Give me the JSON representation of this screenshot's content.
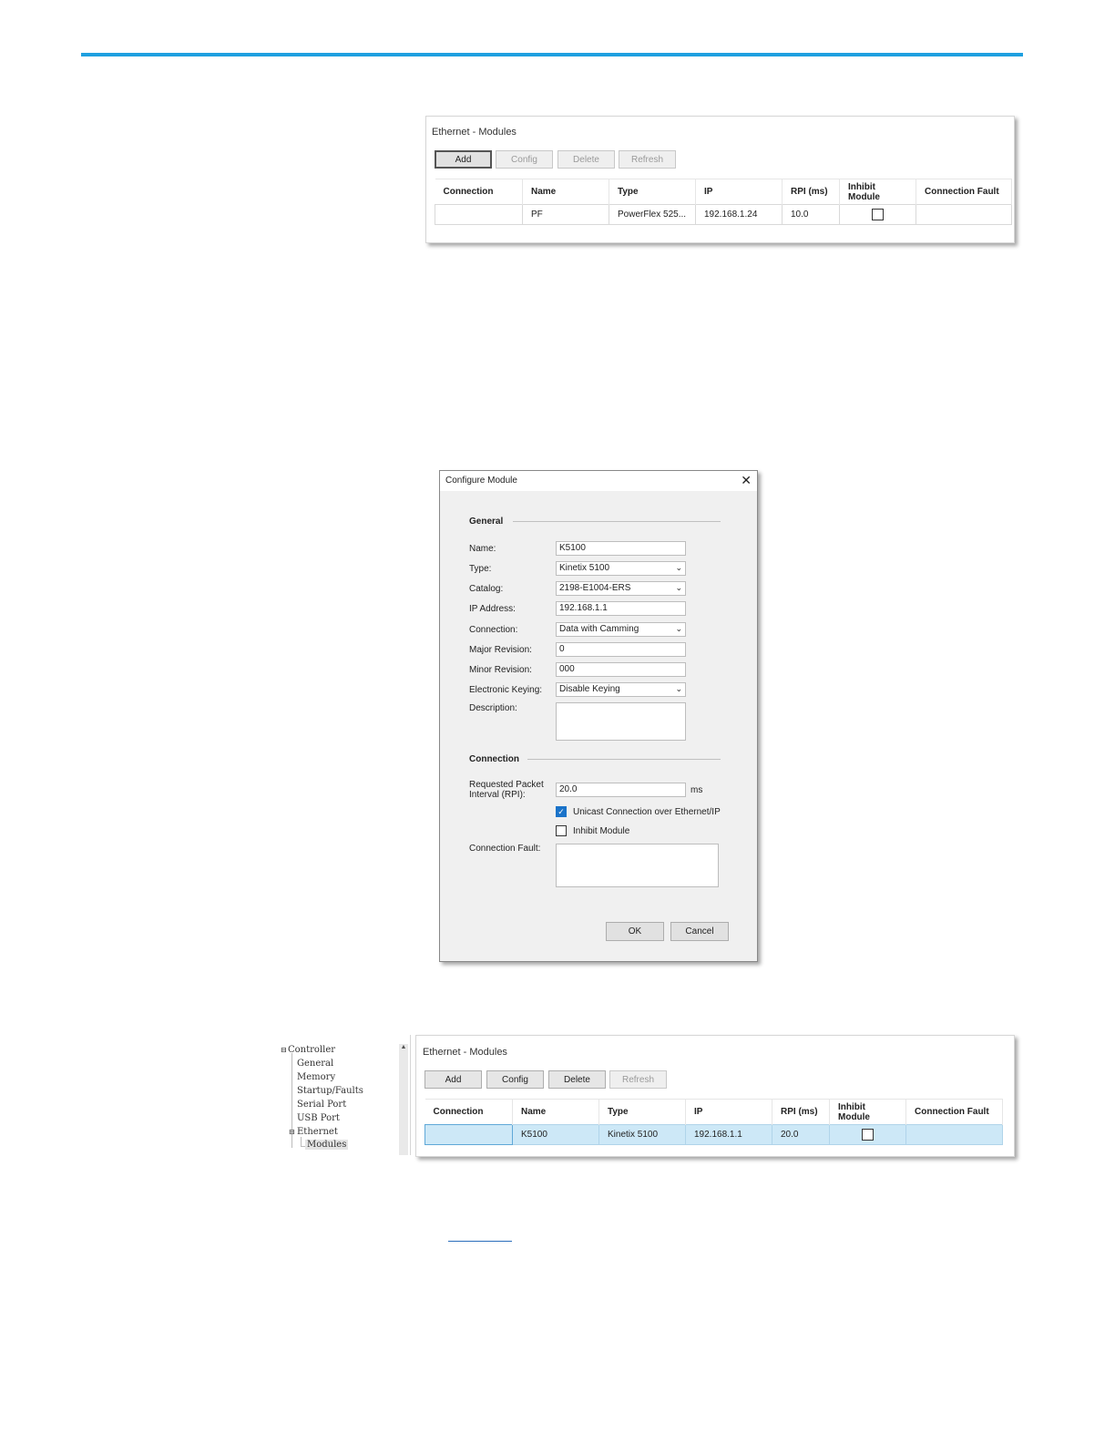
{
  "panel1": {
    "title": "Ethernet - Modules",
    "buttons": {
      "add": "Add",
      "config": "Config",
      "delete": "Delete",
      "refresh": "Refresh"
    },
    "columns": [
      "Connection",
      "Name",
      "Type",
      "IP",
      "RPI (ms)",
      "Inhibit Module",
      "Connection Fault"
    ],
    "row": {
      "connection": "",
      "name": "PF",
      "type": "PowerFlex 525...",
      "ip": "192.168.1.24",
      "rpi": "10.0",
      "inhibit": false,
      "fault": ""
    }
  },
  "dialog": {
    "title": "Configure Module",
    "close": "✕",
    "general_heading": "General",
    "labels": {
      "name": "Name:",
      "type": "Type:",
      "catalog": "Catalog:",
      "ip": "IP Address:",
      "connection": "Connection:",
      "major": "Major Revision:",
      "minor": "Minor Revision:",
      "keying": "Electronic Keying:",
      "description": "Description:"
    },
    "values": {
      "name": "K5100",
      "type": "Kinetix 5100",
      "catalog": "2198-E1004-ERS",
      "ip": "192.168.1.1",
      "connection": "Data with Camming",
      "major": "0",
      "minor": "000",
      "keying": "Disable Keying",
      "description": ""
    },
    "connection_heading": "Connection",
    "rpi_label_1": "Requested Packet",
    "rpi_label_2": "Interval (RPI):",
    "rpi_value": "20.0",
    "rpi_unit": "ms",
    "unicast_label": "Unicast Connection over Ethernet/IP",
    "unicast_checked": true,
    "inhibit_label": "Inhibit Module",
    "inhibit_checked": false,
    "fault_label": "Connection Fault:",
    "ok": "OK",
    "cancel": "Cancel"
  },
  "panel2": {
    "tree": {
      "root": "Controller",
      "items": [
        "General",
        "Memory",
        "Startup/Faults",
        "Serial Port",
        "USB Port",
        "Ethernet"
      ],
      "child": "Modules"
    },
    "title": "Ethernet - Modules",
    "buttons": {
      "add": "Add",
      "config": "Config",
      "delete": "Delete",
      "refresh": "Refresh"
    },
    "columns": [
      "Connection",
      "Name",
      "Type",
      "IP",
      "RPI (ms)",
      "Inhibit Module",
      "Connection Fault"
    ],
    "row": {
      "connection": "",
      "name": "K5100",
      "type": "Kinetix 5100",
      "ip": "192.168.1.1",
      "rpi": "20.0",
      "inhibit": false,
      "fault": ""
    }
  },
  "colors": {
    "accent_rule": "#1ea0e0",
    "selected_row": "#cde8f7",
    "checkbox_checked": "#1a73c9"
  }
}
